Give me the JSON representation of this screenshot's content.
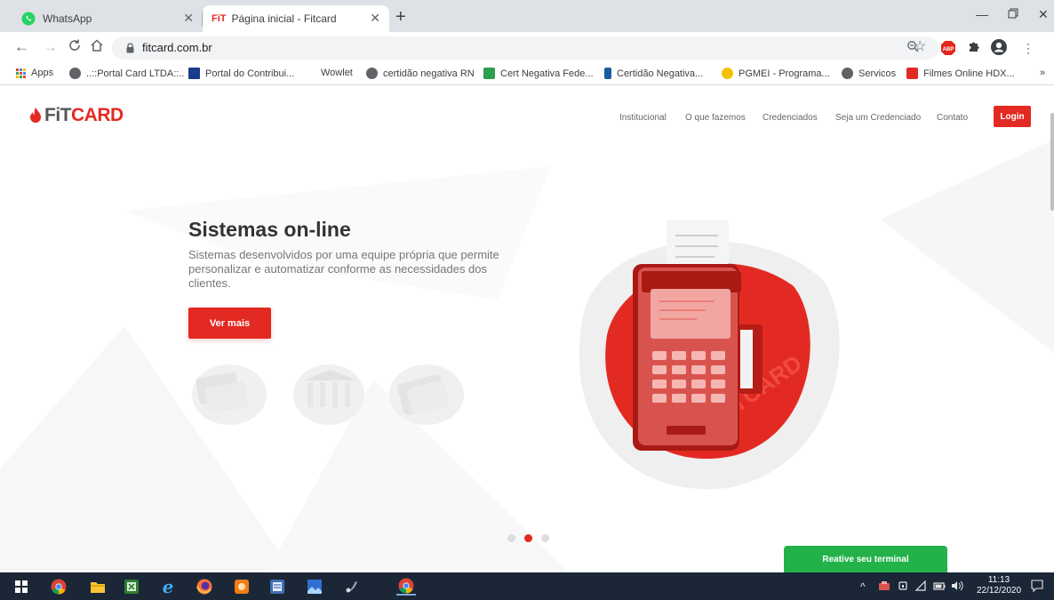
{
  "browser": {
    "tabs": [
      {
        "title": "WhatsApp",
        "favicon": "whatsapp-icon"
      },
      {
        "title": "Página inicial - Fitcard",
        "favicon_text": "FiT",
        "active": true
      }
    ],
    "url": "fitcard.com.br",
    "bookmarks": [
      {
        "label": "Apps"
      },
      {
        "label": "..::Portal Card LTDA::.."
      },
      {
        "label": "Portal do Contribui..."
      },
      {
        "label": "Wowlet"
      },
      {
        "label": "certidão negativa RN"
      },
      {
        "label": "Cert Negativa Fede..."
      },
      {
        "label": "Certidão Negativa..."
      },
      {
        "label": "PGMEI - Programa..."
      },
      {
        "label": "Servicos"
      },
      {
        "label": "Filmes Online HDX..."
      }
    ],
    "bookmarks_more": "»",
    "abp_label": "ABP"
  },
  "site": {
    "logo_prefix": "FiT",
    "logo_suffix": "CARD",
    "nav": [
      "Institucional",
      "O que fazemos",
      "Credenciados",
      "Seja um Credenciado",
      "Contato"
    ],
    "login_label": "Login",
    "hero": {
      "title": "Sistemas on-line",
      "description": "Sistemas desenvolvidos por uma equipe própria que permite personalizar e automatizar conforme as necessidades dos clientes.",
      "cta_label": "Ver mais",
      "watermark": "FITCARD"
    },
    "carousel": {
      "total": 3,
      "active_index": 1
    },
    "reactivate_label": "Reative seu terminal"
  },
  "taskbar": {
    "time": "11:13",
    "date": "22/12/2020"
  },
  "colors": {
    "brand_red": "#e32a22",
    "green": "#23b24a",
    "taskbar": "#1b2736"
  }
}
